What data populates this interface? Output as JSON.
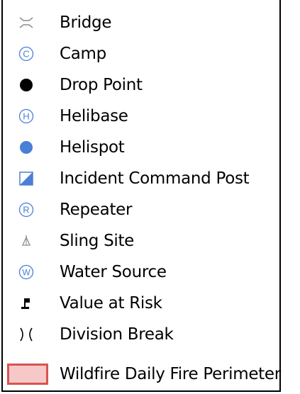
{
  "legend": {
    "items": [
      {
        "label": "Bridge",
        "icon": "bridge-icon"
      },
      {
        "label": "Camp",
        "icon": "camp-icon"
      },
      {
        "label": "Drop Point",
        "icon": "drop-point-icon"
      },
      {
        "label": "Helibase",
        "icon": "helibase-icon"
      },
      {
        "label": "Helispot",
        "icon": "helispot-icon"
      },
      {
        "label": "Incident Command Post",
        "icon": "incident-command-post-icon"
      },
      {
        "label": "Repeater",
        "icon": "repeater-icon"
      },
      {
        "label": "Sling Site",
        "icon": "sling-site-icon"
      },
      {
        "label": "Water Source",
        "icon": "water-source-icon"
      },
      {
        "label": "Value at Risk",
        "icon": "value-at-risk-icon"
      },
      {
        "label": "Division Break",
        "icon": "division-break-icon"
      },
      {
        "label": "Wildfire Daily Fire Perimeter",
        "icon": "fire-perimeter-swatch"
      }
    ],
    "colors": {
      "symbol_blue": "#4a7fd6",
      "symbol_grey": "#8c8c8c",
      "perimeter_fill": "#f7c8c8",
      "perimeter_stroke": "#d9534f"
    }
  }
}
